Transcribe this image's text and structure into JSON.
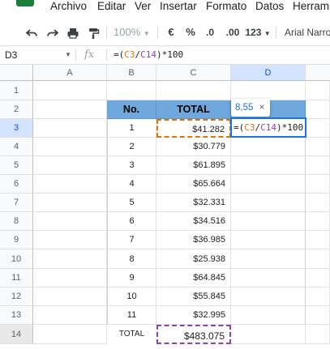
{
  "menu": [
    "Archivo",
    "Editar",
    "Ver",
    "Insertar",
    "Formato",
    "Datos",
    "Herrami"
  ],
  "toolbar": {
    "zoom": "100%",
    "currency": "€",
    "percent": "%",
    "dec_decrease": ".0",
    "dec_increase": ".00",
    "more_formats": "123",
    "font": "Arial Narrow"
  },
  "name_box": "D3",
  "fx": "fx",
  "formula": {
    "prefix": "=(",
    "ref1": "C3",
    "slash": "/",
    "ref2": "C14",
    "suffix": ")*100"
  },
  "columns": [
    "A",
    "B",
    "C",
    "D"
  ],
  "rows": [
    "1",
    "2",
    "3",
    "4",
    "5",
    "6",
    "7",
    "8",
    "9",
    "10",
    "11",
    "12",
    "13",
    "14"
  ],
  "table": {
    "header_no": "No.",
    "header_total": "TOTAL",
    "items": [
      {
        "no": "1",
        "total": "$41.282"
      },
      {
        "no": "2",
        "total": "$30.779"
      },
      {
        "no": "3",
        "total": "$61.895"
      },
      {
        "no": "4",
        "total": "$65.664"
      },
      {
        "no": "5",
        "total": "$32.331"
      },
      {
        "no": "6",
        "total": "$34.516"
      },
      {
        "no": "7",
        "total": "$36.985"
      },
      {
        "no": "8",
        "total": "$25.938"
      },
      {
        "no": "9",
        "total": "$64.845"
      },
      {
        "no": "10",
        "total": "$55.845"
      },
      {
        "no": "11",
        "total": "$32.995"
      }
    ],
    "total_label": "TOTAL",
    "total_value": "$483.075"
  },
  "hint": {
    "value": "8,55",
    "close": "×"
  },
  "colors": {
    "header_blue": "#6fa8dc",
    "ref_orange": "#e37400",
    "ref_purple": "#8e44ad",
    "active_blue": "#1a73e8",
    "logo_green": "#188038"
  }
}
